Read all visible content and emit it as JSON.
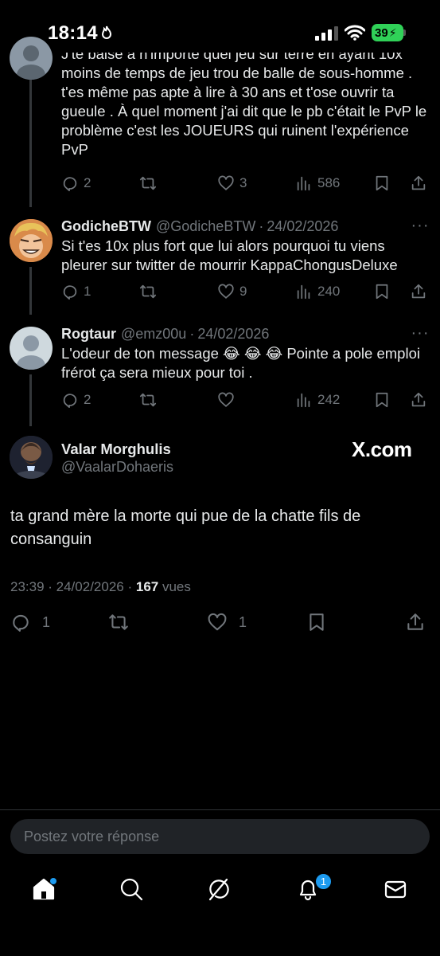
{
  "status_bar": {
    "time": "18:14",
    "battery": "39"
  },
  "previous_tweet": {
    "text_line0": "J'te baise à n'importe quel jeu sur terre en ayant 10x",
    "text_rest": "moins de temps de jeu trou de balle de sous-homme . t'es même pas apte à lire à 30 ans et t'ose ouvrir ta gueule . À quel moment j'ai dit que le pb c'était le PvP le problème c'est les JOUEURS qui ruinent l'expérience PvP",
    "replies": "2",
    "likes": "3",
    "views": "586"
  },
  "reply1": {
    "name": "GodicheBTW",
    "handle": "@GodicheBTW",
    "separator": "·",
    "date": "24/02/2026",
    "text": "Si t'es 10x plus fort que lui alors pourquoi tu viens pleurer sur twitter de mourrir KappaChongusDeluxe",
    "replies": "1",
    "likes": "9",
    "views": "240"
  },
  "reply2": {
    "name": "Rogtaur",
    "handle": "@emz00u",
    "separator": "·",
    "date": "24/02/2026",
    "text": "L'odeur de ton message 😂 😂 😂  Pointe a pole emploi frérot ça sera mieux pour toi .",
    "replies": "2",
    "views": "242"
  },
  "main_tweet": {
    "name": "Valar Morghulis",
    "handle": "@VaalarDohaeris",
    "source": "X.com",
    "text": "ta grand mère la morte qui pue de la chatte fils de consanguin",
    "time_date": "23:39 · 24/02/2026 ·",
    "views_count": "167",
    "views_label": "vues",
    "replies": "1",
    "likes": "1"
  },
  "reply_box": {
    "placeholder": "Postez votre réponse"
  },
  "nav": {
    "notifications_badge": "1"
  },
  "icons": [
    "fire-icon",
    "signal-icon",
    "wifi-icon",
    "reply-icon",
    "retweet-icon",
    "like-icon",
    "views-icon",
    "bookmark-icon",
    "share-icon",
    "more-icon",
    "home-icon",
    "search-icon",
    "grok-icon",
    "bell-icon",
    "mail-icon"
  ],
  "colors": {
    "background": "#000000",
    "text": "#e7e9ea",
    "muted": "#71767b",
    "accent": "#1d9bf0",
    "battery": "#30d158"
  }
}
